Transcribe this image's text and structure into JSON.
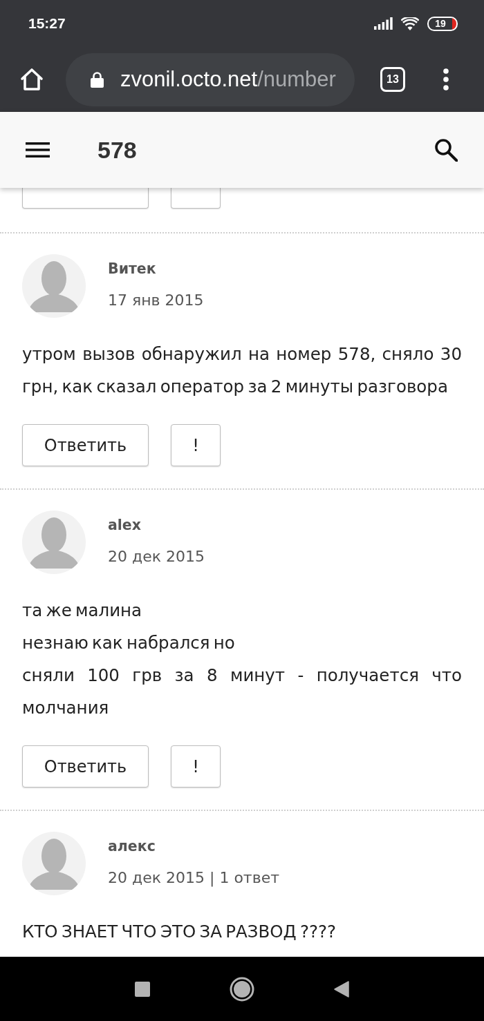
{
  "status_bar": {
    "time": "15:27",
    "battery": "19"
  },
  "browser": {
    "url_host": "zvonil.octo.net",
    "url_path": "/number",
    "tab_count": "13"
  },
  "header": {
    "title": "578"
  },
  "partial_actions": [
    {
      "kind": "reply"
    },
    {
      "kind": "report"
    }
  ],
  "comments": [
    {
      "author": "Витек",
      "meta": "17 янв 2015",
      "lines": [
        "утром вызов обнаружил на номер 578, сняло 30 грн, как сказал оператор за 2 минуты разговора"
      ],
      "actions": [
        {
          "kind": "reply",
          "label": "Ответить"
        },
        {
          "kind": "report",
          "label": "!"
        }
      ]
    },
    {
      "author": "alex",
      "meta": "20 дек 2015",
      "lines": [
        "та же малина",
        "незнаю как набрался но",
        "сняли 100 грв за 8 минут - получается что молчания"
      ],
      "actions": [
        {
          "kind": "reply",
          "label": "Ответить"
        },
        {
          "kind": "report",
          "label": "!"
        }
      ]
    },
    {
      "author": "алекс",
      "meta": "20 дек 2015 | 1 ответ",
      "lines": [
        "КТО ЗНАЕТ ЧТО ЭТО ЗА РАЗВОД ????"
      ]
    }
  ]
}
